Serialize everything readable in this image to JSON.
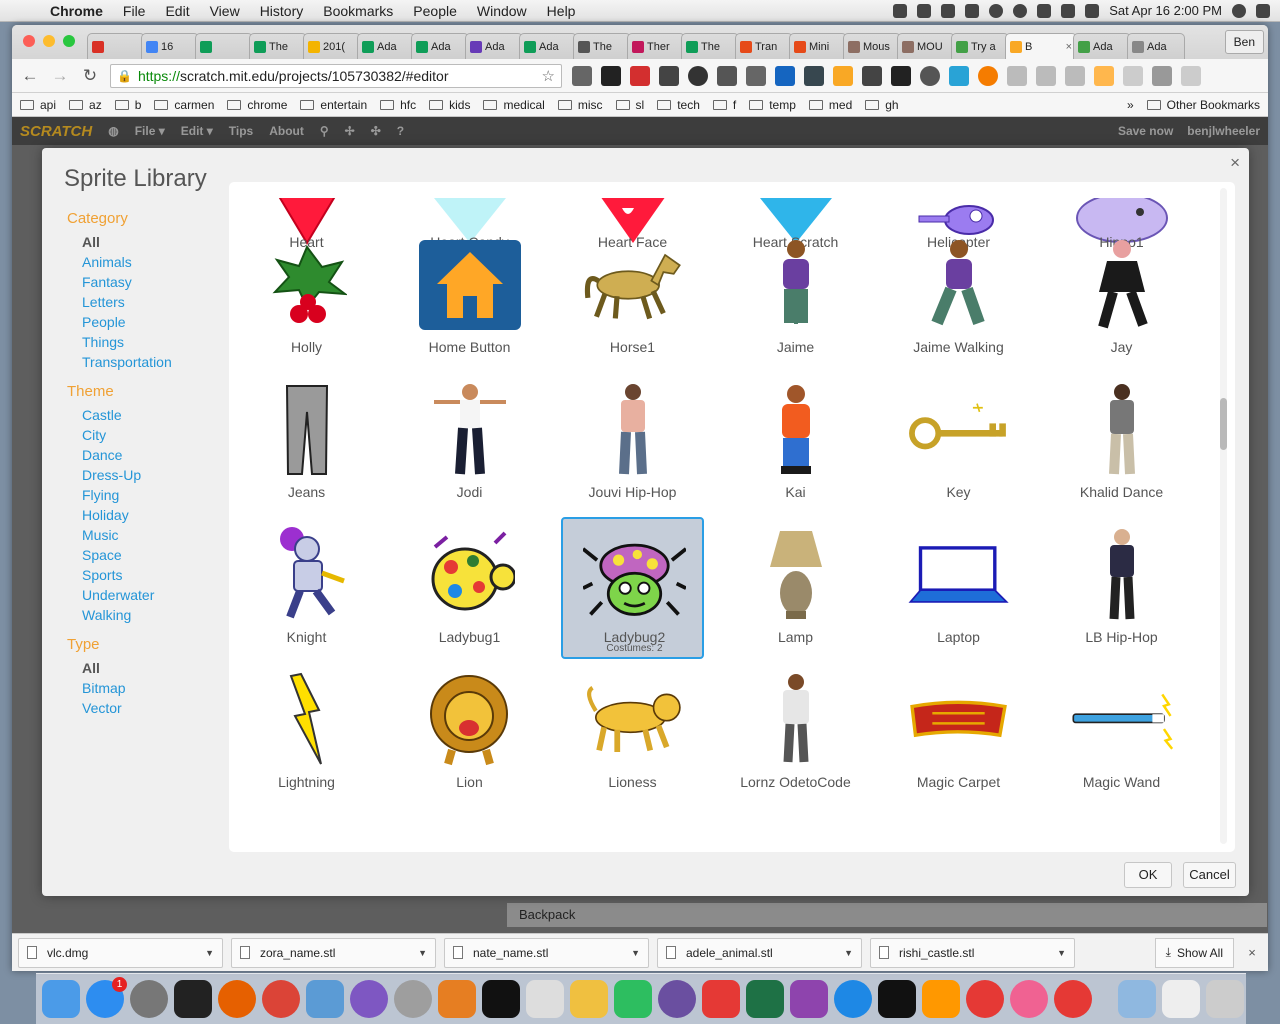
{
  "menubar": {
    "app": "Chrome",
    "items": [
      "File",
      "Edit",
      "View",
      "History",
      "Bookmarks",
      "People",
      "Window",
      "Help"
    ],
    "clock": "Sat Apr 16  2:00 PM"
  },
  "browser": {
    "tabs": [
      {
        "label": "",
        "color": "#d93025"
      },
      {
        "label": "16",
        "color": "#4285f4"
      },
      {
        "label": "",
        "color": "#0f9d58"
      },
      {
        "label": "The",
        "color": "#0f9d58"
      },
      {
        "label": "201(",
        "color": "#f4b400"
      },
      {
        "label": "Ada",
        "color": "#0f9d58"
      },
      {
        "label": "Ada",
        "color": "#0f9d58"
      },
      {
        "label": "Ada",
        "color": "#673ab7"
      },
      {
        "label": "Ada",
        "color": "#0f9d58"
      },
      {
        "label": "The",
        "color": "#555555"
      },
      {
        "label": "Ther",
        "color": "#c2185b"
      },
      {
        "label": "The",
        "color": "#0f9d58"
      },
      {
        "label": "Tran",
        "color": "#e64a19"
      },
      {
        "label": "Mini",
        "color": "#e64a19"
      },
      {
        "label": "Mous",
        "color": "#8d6e63"
      },
      {
        "label": "MOU",
        "color": "#8d6e63"
      },
      {
        "label": "Try a",
        "color": "#43a047"
      },
      {
        "label": "B",
        "color": "#f9a825",
        "active": true
      },
      {
        "label": "Ada",
        "color": "#43a047"
      },
      {
        "label": "Ada",
        "color": "#888888"
      }
    ],
    "user": "Ben",
    "url_scheme": "https://",
    "url_rest": "scratch.mit.edu/projects/105730382/#editor",
    "bookmarks": [
      "api",
      "az",
      "b",
      "carmen",
      "chrome",
      "entertain",
      "hfc",
      "kids",
      "medical",
      "misc",
      "sl",
      "tech",
      "f",
      "temp",
      "med",
      "gh"
    ],
    "bookmarks_overflow": "»",
    "other_bookmarks": "Other Bookmarks"
  },
  "scratch": {
    "logo": "SCRATCH",
    "menu": [
      "File ▾",
      "Edit ▾",
      "Tips",
      "About"
    ],
    "save": "Save now",
    "user": "benjlwheeler",
    "backpack": "Backpack"
  },
  "library": {
    "title": "Sprite Library",
    "close": "×",
    "category_heading": "Category",
    "categories": [
      "All",
      "Animals",
      "Fantasy",
      "Letters",
      "People",
      "Things",
      "Transportation"
    ],
    "theme_heading": "Theme",
    "themes": [
      "Castle",
      "City",
      "Dance",
      "Dress-Up",
      "Flying",
      "Holiday",
      "Music",
      "Space",
      "Sports",
      "Underwater",
      "Walking"
    ],
    "type_heading": "Type",
    "types": [
      "All",
      "Bitmap",
      "Vector"
    ],
    "sprites": [
      "Heart",
      "Heart Candy",
      "Heart Face",
      "Heart Scratch",
      "Helicopter",
      "Hippo1",
      "Holly",
      "Home Button",
      "Horse1",
      "Jaime",
      "Jaime Walking",
      "Jay",
      "Jeans",
      "Jodi",
      "Jouvi Hip-Hop",
      "Kai",
      "Key",
      "Khalid Dance",
      "Knight",
      "Ladybug1",
      "Ladybug2",
      "Lamp",
      "Laptop",
      "LB Hip-Hop",
      "Lightning",
      "Lion",
      "Lioness",
      "Lornz OdetoCode",
      "Magic Carpet",
      "Magic Wand"
    ],
    "selected_sprite": "Ladybug2",
    "selected_costumes": "Costumes: 2",
    "ok": "OK",
    "cancel": "Cancel"
  },
  "downloads": {
    "files": [
      "vlc.dmg",
      "zora_name.stl",
      "nate_name.stl",
      "adele_animal.stl",
      "rishi_castle.stl"
    ],
    "show_all": "Show All",
    "close": "×"
  },
  "dock": {
    "appstore_badge": "1"
  }
}
